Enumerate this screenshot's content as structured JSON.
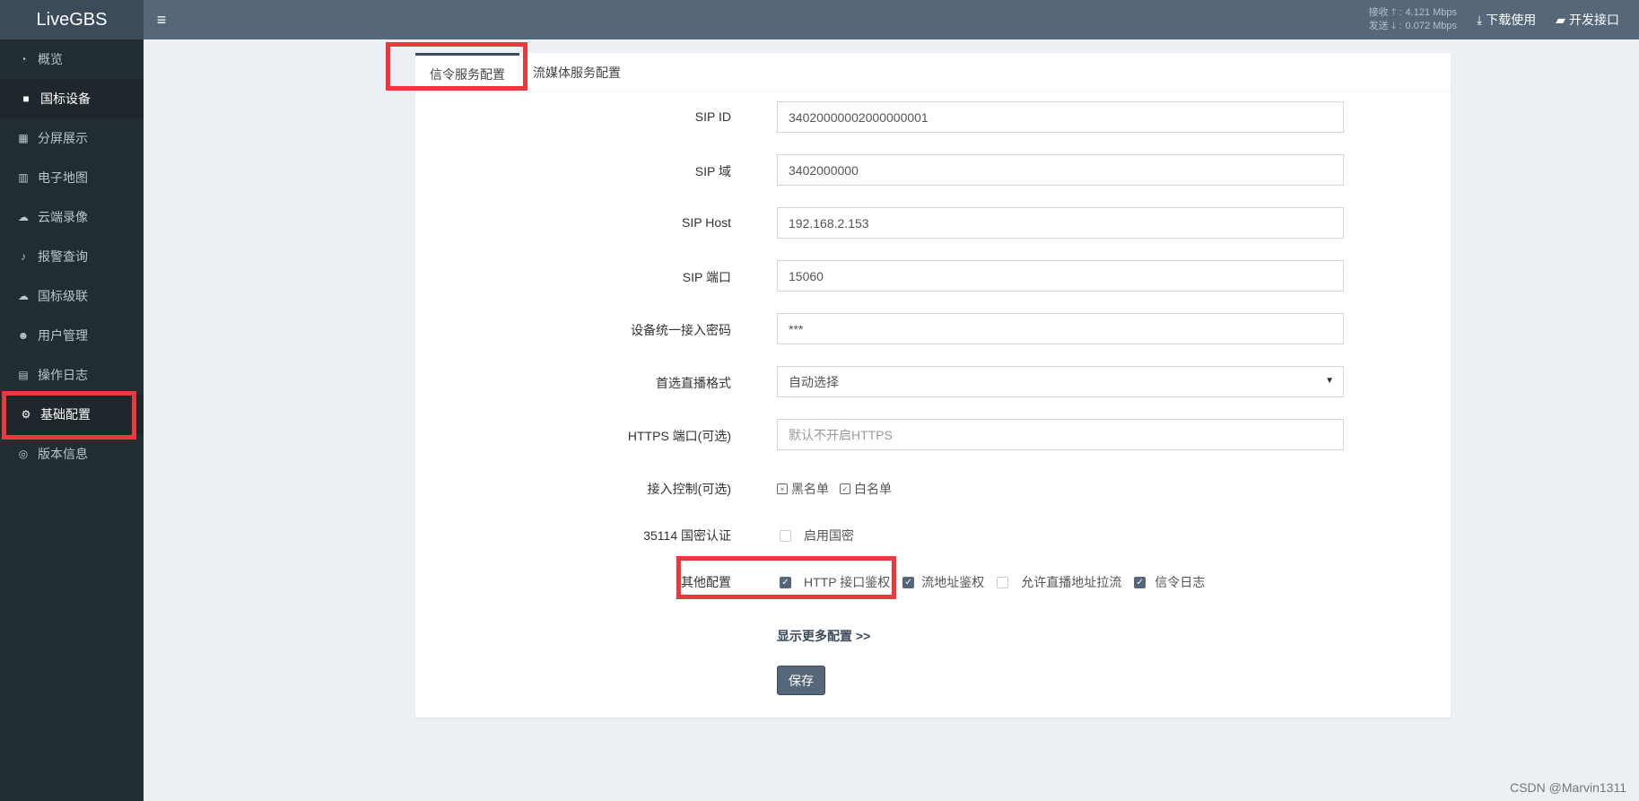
{
  "app": {
    "title": "LiveGBS"
  },
  "sidebar": {
    "items": [
      {
        "label": "概览",
        "icon": "dashboard-icon"
      },
      {
        "label": "国标设备",
        "icon": "video-camera-icon"
      },
      {
        "label": "分屏展示",
        "icon": "grid-icon"
      },
      {
        "label": "电子地图",
        "icon": "map-icon"
      },
      {
        "label": "云端录像",
        "icon": "cloud-icon"
      },
      {
        "label": "报警查询",
        "icon": "bell-icon"
      },
      {
        "label": "国标级联",
        "icon": "cloud-upload-icon"
      },
      {
        "label": "用户管理",
        "icon": "users-icon"
      },
      {
        "label": "操作日志",
        "icon": "file-icon"
      },
      {
        "label": "基础配置",
        "icon": "cogs-icon"
      },
      {
        "label": "版本信息",
        "icon": "life-ring-icon"
      }
    ]
  },
  "header": {
    "recv_label": "接收 🡑 :",
    "recv_value": "4.121 Mbps",
    "send_label": "发送 🡓 :",
    "send_value": "0.072 Mbps",
    "download_label": "下载使用",
    "api_label": "开发接口"
  },
  "tabs": [
    {
      "label": "信令服务配置"
    },
    {
      "label": "流媒体服务配置"
    }
  ],
  "form": {
    "sip_id": {
      "label": "SIP ID",
      "value": "34020000002000000001"
    },
    "sip_domain": {
      "label": "SIP 域",
      "value": "3402000000"
    },
    "sip_host": {
      "label": "SIP Host",
      "value": "192.168.2.153"
    },
    "sip_port": {
      "label": "SIP 端口",
      "value": "15060"
    },
    "device_password": {
      "label": "设备统一接入密码",
      "value": "***"
    },
    "live_format": {
      "label": "首选直播格式",
      "value": "自动选择"
    },
    "https_port": {
      "label": "HTTPS 端口(可选)",
      "placeholder": "默认不开启HTTPS"
    },
    "access_control": {
      "label": "接入控制(可选)",
      "blacklist": "黑名单",
      "whitelist": "白名单"
    },
    "gm_auth": {
      "label": "35114 国密认证",
      "option": "启用国密"
    },
    "other": {
      "label": "其他配置",
      "http_auth": "HTTP 接口鉴权",
      "stream_auth": "流地址鉴权",
      "allow_pull": "允许直播地址拉流",
      "sip_log": "信令日志"
    },
    "more_label": "显示更多配置 >>",
    "save_label": "保存"
  },
  "watermark": "CSDN @Marvin1311",
  "colors": {
    "highlight": "#e8393d",
    "sidebar": "#222d32",
    "header": "#56677a"
  }
}
